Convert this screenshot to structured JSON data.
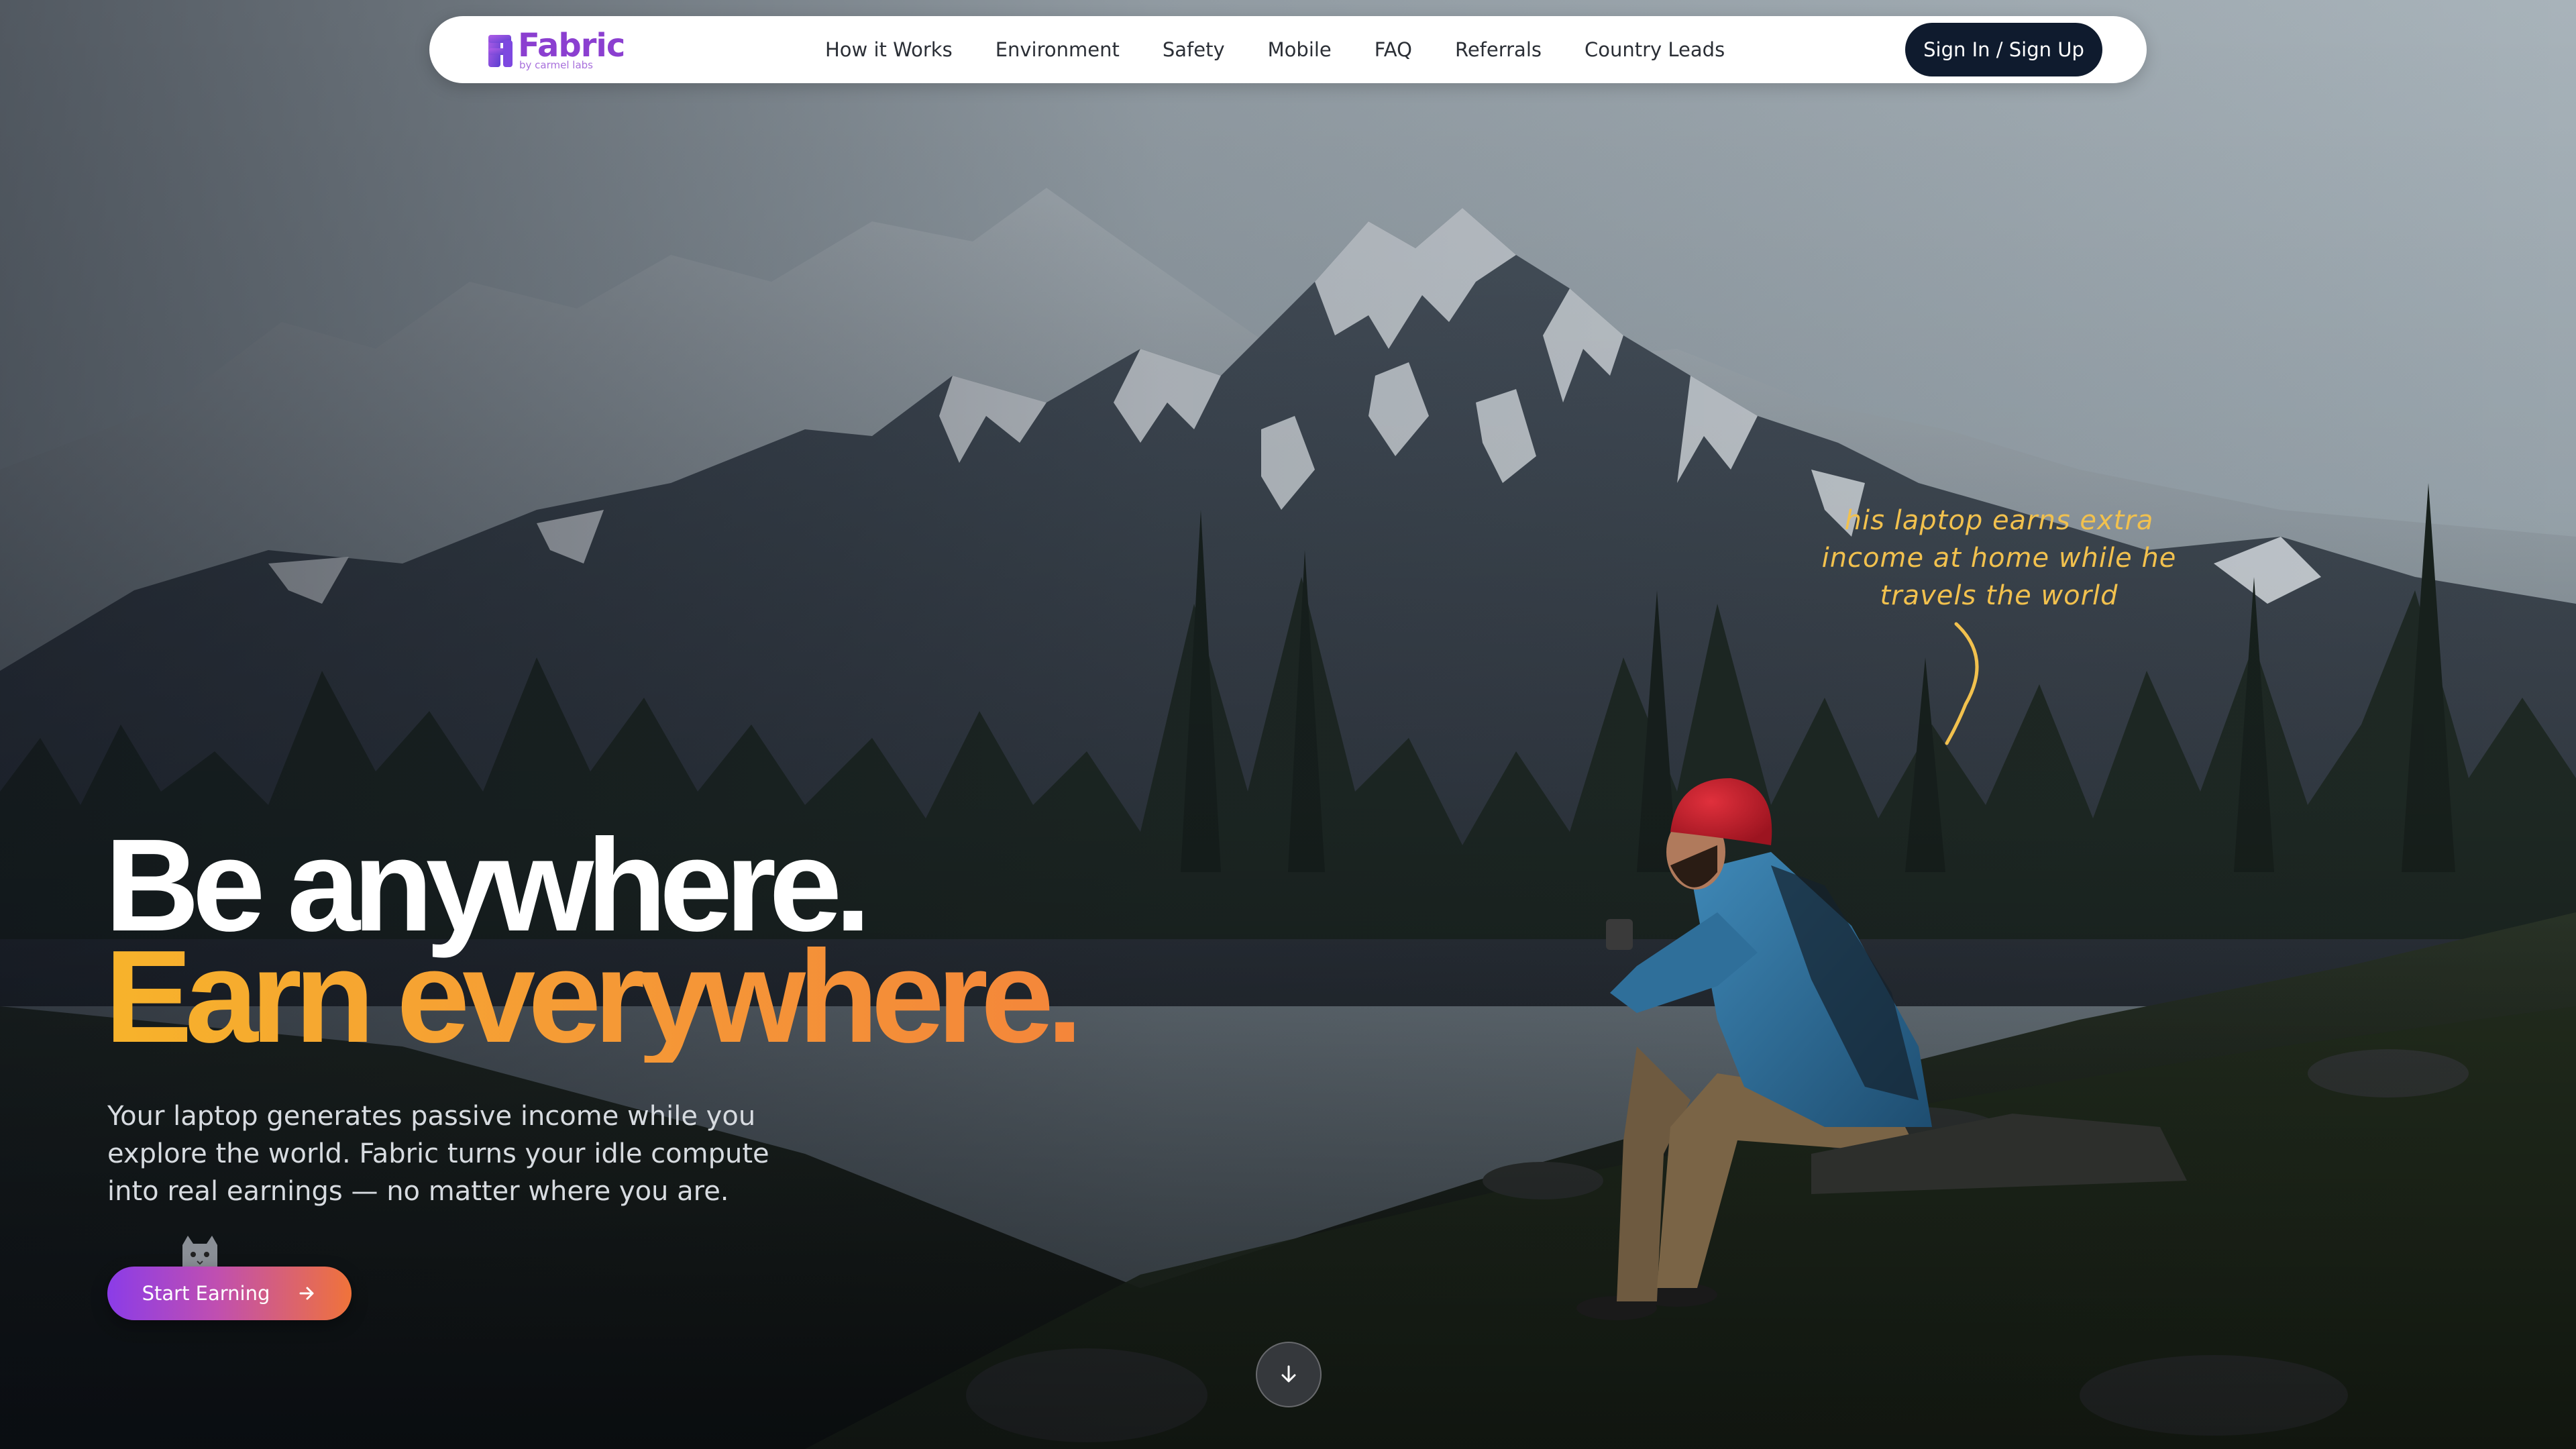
{
  "brand": {
    "name": "Fabric",
    "tagline": "by carmel labs",
    "colors": {
      "primary_purple": "#8b3fd0",
      "accent_orange": "#f4863a",
      "accent_yellow": "#f7b32b",
      "nav_dark": "#0f1b2e"
    }
  },
  "nav": {
    "links": [
      "How it Works",
      "Environment",
      "Safety",
      "Mobile",
      "FAQ",
      "Referrals",
      "Country Leads"
    ],
    "signin_label": "Sign In / Sign Up"
  },
  "annotation": {
    "lines": [
      "his laptop earns extra",
      "income at home while he",
      "travels the world"
    ]
  },
  "hero": {
    "headline_1": "Be anywhere.",
    "headline_2": "Earn everywhere.",
    "subtitle": "Your laptop generates passive income while you explore the world. Fabric turns your idle compute into real earnings — no matter where you are."
  },
  "cta": {
    "label": "Start Earning",
    "icon": "arrow-right-icon"
  },
  "scroll": {
    "icon": "arrow-down-icon"
  },
  "background": {
    "icon": "mountain-hiker-photo"
  }
}
